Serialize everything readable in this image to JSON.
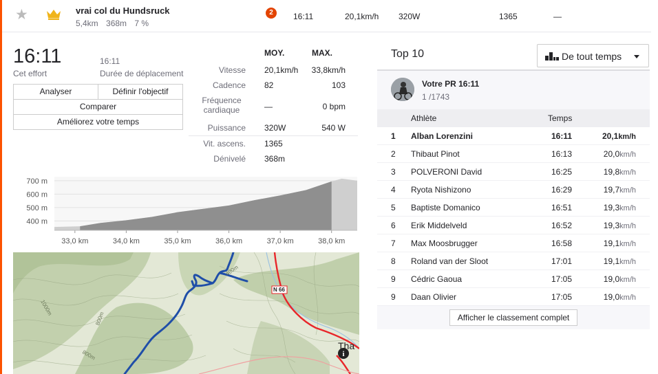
{
  "segment": {
    "name": "vrai col du Hundsruck",
    "distance": "5,4km",
    "elevation": "368m",
    "grade": "7 %",
    "rank_badge": "2",
    "time": "16:11",
    "speed": "20,1km/h",
    "power": "320W",
    "vam": "1365",
    "hr": "—"
  },
  "effort": {
    "time": "16:11",
    "time_label": "Cet effort",
    "moving_time": "16:11",
    "moving_time_label": "Durée de déplacement"
  },
  "buttons": {
    "analyze": "Analyser",
    "goal": "Définir l'objectif",
    "compare": "Comparer",
    "improve": "Améliorez votre temps"
  },
  "stats": {
    "col_avg": "MOY.",
    "col_max": "MAX.",
    "rows": [
      {
        "label": "Vitesse",
        "avg": "20,1km/h",
        "max": "33,8km/h"
      },
      {
        "label": "Cadence",
        "avg": "82",
        "max": "103"
      },
      {
        "label": "Fréquence cardiaque",
        "avg": "—",
        "max": "0 bpm"
      },
      {
        "label": "Puissance",
        "avg": "320W",
        "max": "540 W"
      },
      {
        "label": "Vit. ascens.",
        "avg": "1365",
        "max": ""
      },
      {
        "label": "Dénivelé",
        "avg": "368m",
        "max": ""
      }
    ]
  },
  "chart_data": {
    "type": "area",
    "title": "",
    "xlabel": "",
    "ylabel": "",
    "x_ticks": [
      "33,0 km",
      "34,0 km",
      "35,0 km",
      "36,0 km",
      "37,0 km",
      "38,0 km"
    ],
    "y_ticks": [
      "700 m",
      "600 m",
      "500 m",
      "400 m"
    ],
    "xlim": [
      32.6,
      38.5
    ],
    "ylim": [
      330,
      730
    ],
    "x": [
      32.6,
      33.1,
      33.5,
      34.0,
      34.5,
      35.0,
      35.5,
      36.0,
      36.5,
      37.0,
      37.5,
      38.0,
      38.2,
      38.5
    ],
    "y": [
      355,
      360,
      385,
      405,
      430,
      465,
      490,
      515,
      555,
      590,
      630,
      695,
      715,
      700
    ],
    "segment_range": [
      33.1,
      38.0
    ],
    "grid": true
  },
  "map": {
    "road_label": "N 66",
    "town_label": "Tha",
    "contour_labels": [
      "400m",
      "1000m",
      "800m",
      "800m"
    ],
    "route_color": "#1f4ea8",
    "road_color": "#e8262a"
  },
  "leaderboard": {
    "title": "Top 10",
    "filter": "De tout temps",
    "pr_title": "Votre PR 16:11",
    "pr_rank": "1",
    "pr_total": "/1743",
    "col_athlete": "Athlète",
    "col_time": "Temps",
    "rows": [
      {
        "rank": "1",
        "name": "Alban Lorenzini",
        "time": "16:11",
        "speed": "20,1",
        "unit": "km/h"
      },
      {
        "rank": "2",
        "name": "Thibaut Pinot",
        "time": "16:13",
        "speed": "20,0",
        "unit": "km/h"
      },
      {
        "rank": "3",
        "name": "POLVERONI David",
        "time": "16:25",
        "speed": "19,8",
        "unit": "km/h"
      },
      {
        "rank": "4",
        "name": "Ryota Nishizono",
        "time": "16:29",
        "speed": "19,7",
        "unit": "km/h"
      },
      {
        "rank": "5",
        "name": "Baptiste Domanico",
        "time": "16:51",
        "speed": "19,3",
        "unit": "km/h"
      },
      {
        "rank": "6",
        "name": "Erik Middelveld",
        "time": "16:52",
        "speed": "19,3",
        "unit": "km/h"
      },
      {
        "rank": "7",
        "name": "Max Moosbrugger",
        "time": "16:58",
        "speed": "19,1",
        "unit": "km/h"
      },
      {
        "rank": "8",
        "name": "Roland van der Sloot",
        "time": "17:01",
        "speed": "19,1",
        "unit": "km/h"
      },
      {
        "rank": "9",
        "name": "Cédric Gaoua",
        "time": "17:05",
        "speed": "19,0",
        "unit": "km/h"
      },
      {
        "rank": "9",
        "name": "Daan Olivier",
        "time": "17:05",
        "speed": "19,0",
        "unit": "km/h"
      }
    ],
    "full_button": "Afficher le classement complet"
  },
  "colors": {
    "accent": "#fc5200",
    "badge": "#e34402",
    "crown": "#f0b419"
  }
}
